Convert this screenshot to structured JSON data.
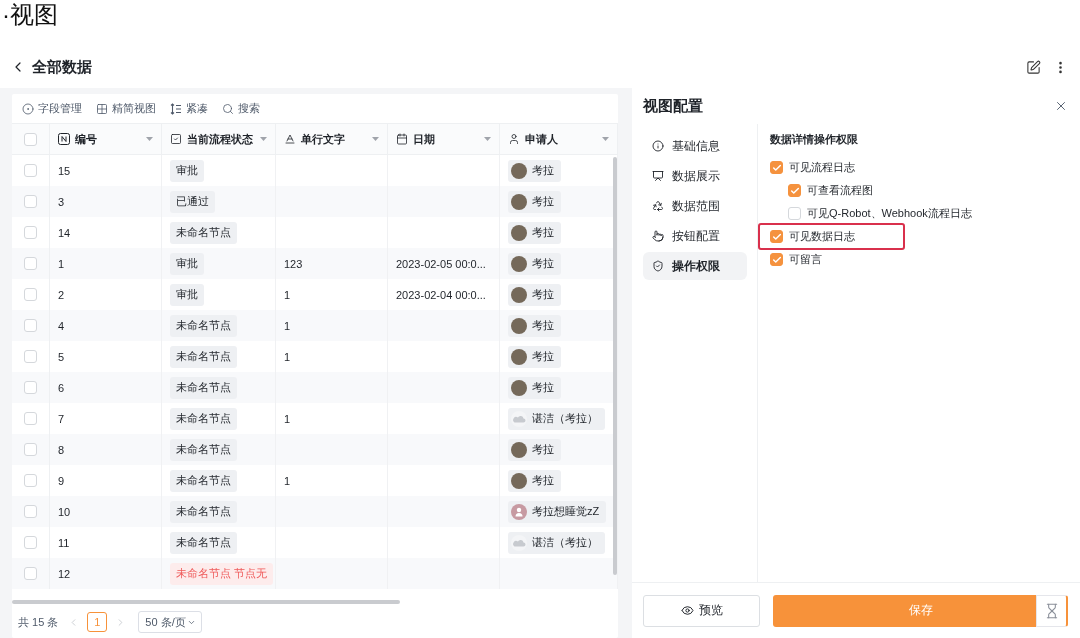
{
  "page_title": "·视图",
  "header": {
    "title": "全部数据"
  },
  "toolbar": [
    {
      "label": "字段管理"
    },
    {
      "label": "精简视图"
    },
    {
      "label": "紧凑"
    },
    {
      "label": "搜索"
    }
  ],
  "table": {
    "select_all": {
      "checked": false
    },
    "columns": [
      {
        "label": "编号",
        "kind": "number"
      },
      {
        "label": "当前流程状态",
        "kind": "status"
      },
      {
        "label": "单行文字",
        "kind": "text"
      },
      {
        "label": "日期",
        "kind": "date"
      },
      {
        "label": "申请人",
        "kind": "user"
      }
    ],
    "rows": [
      {
        "checked": false,
        "number": "15",
        "status": {
          "label": "审批",
          "kind": "normal"
        },
        "user": {
          "name": "考拉",
          "kind": "photo"
        }
      },
      {
        "checked": false,
        "number": "3",
        "status": {
          "label": "已通过",
          "kind": "normal"
        },
        "user": {
          "name": "考拉",
          "kind": "photo"
        }
      },
      {
        "checked": false,
        "number": "14",
        "status": {
          "label": "未命名节点",
          "kind": "normal"
        },
        "user": {
          "name": "考拉",
          "kind": "photo"
        }
      },
      {
        "checked": false,
        "number": "1",
        "status": {
          "label": "审批",
          "kind": "normal"
        },
        "text": "123",
        "date": "2023-02-05 00:0...",
        "user": {
          "name": "考拉",
          "kind": "photo"
        }
      },
      {
        "checked": false,
        "number": "2",
        "status": {
          "label": "审批",
          "kind": "normal"
        },
        "text": "1",
        "date": "2023-02-04 00:0...",
        "user": {
          "name": "考拉",
          "kind": "photo"
        }
      },
      {
        "checked": false,
        "number": "4",
        "status": {
          "label": "未命名节点",
          "kind": "normal"
        },
        "text": "1",
        "user": {
          "name": "考拉",
          "kind": "photo"
        }
      },
      {
        "checked": false,
        "number": "5",
        "status": {
          "label": "未命名节点",
          "kind": "normal"
        },
        "text": "1",
        "user": {
          "name": "考拉",
          "kind": "photo"
        }
      },
      {
        "checked": false,
        "number": "6",
        "status": {
          "label": "未命名节点",
          "kind": "normal"
        },
        "user": {
          "name": "考拉",
          "kind": "photo"
        }
      },
      {
        "checked": false,
        "number": "7",
        "status": {
          "label": "未命名节点",
          "kind": "normal"
        },
        "text": "1",
        "user": {
          "name": "谌洁（考拉）",
          "kind": "cloud"
        }
      },
      {
        "checked": false,
        "number": "8",
        "status": {
          "label": "未命名节点",
          "kind": "normal"
        },
        "user": {
          "name": "考拉",
          "kind": "photo"
        }
      },
      {
        "checked": false,
        "number": "9",
        "status": {
          "label": "未命名节点",
          "kind": "normal"
        },
        "text": "1",
        "user": {
          "name": "考拉",
          "kind": "photo"
        }
      },
      {
        "checked": false,
        "number": "10",
        "status": {
          "label": "未命名节点",
          "kind": "normal"
        },
        "user": {
          "name": "考拉想睡觉zZ",
          "kind": "person"
        }
      },
      {
        "checked": false,
        "number": "11",
        "status": {
          "label": "未命名节点",
          "kind": "normal"
        },
        "user": {
          "name": "谌洁（考拉）",
          "kind": "cloud"
        }
      },
      {
        "checked": false,
        "number": "12",
        "status": {
          "label": "未命名节点 节点无",
          "kind": "error"
        }
      }
    ]
  },
  "pagination": {
    "total": "共 15 条",
    "prev_disabled": true,
    "pages": [
      {
        "label": "1",
        "selected": true
      }
    ],
    "next_disabled": true,
    "page_size": "50 条/页"
  },
  "panel": {
    "title": "视图配置",
    "nav": [
      {
        "label": "基础信息",
        "selected": false
      },
      {
        "label": "数据展示",
        "selected": false
      },
      {
        "label": "数据范围",
        "selected": false
      },
      {
        "label": "按钮配置",
        "selected": false
      },
      {
        "label": "操作权限",
        "selected": true
      }
    ],
    "section_title": "数据详情操作权限",
    "options": [
      {
        "label": "可见流程日志",
        "checked": true,
        "highlighted": false,
        "children": [
          {
            "label": "可查看流程图",
            "checked": true,
            "highlighted": false
          },
          {
            "label": "可见Q-Robot、Webhook流程日志",
            "checked": false,
            "highlighted": false
          }
        ]
      },
      {
        "label": "可见数据日志",
        "checked": true,
        "highlighted": true
      },
      {
        "label": "可留言",
        "checked": true,
        "highlighted": false
      }
    ],
    "buttons": {
      "preview": "预览",
      "save": "保存"
    }
  }
}
